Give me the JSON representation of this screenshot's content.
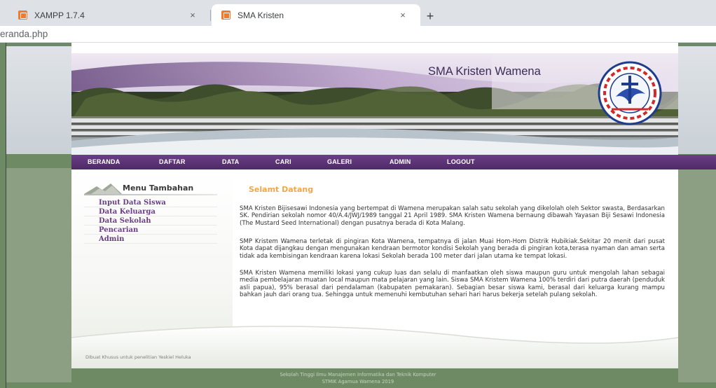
{
  "browser": {
    "tabs": [
      {
        "label": "XAMPP 1.7.4",
        "active": false
      },
      {
        "label": "SMA Kristen",
        "active": true
      }
    ],
    "close_glyph": "×",
    "new_tab_glyph": "+",
    "address": "eranda.php"
  },
  "header": {
    "site_title": "SMA Kristen Wamena"
  },
  "nav": {
    "items": [
      "BERANDA",
      "DAFTAR",
      "DATA",
      "CARI",
      "GALERI",
      "ADMIN",
      "LOGOUT"
    ]
  },
  "sidebar": {
    "title": "Menu Tambahan",
    "items": [
      "Input Data Siswa",
      "Data Keluarga",
      "Data Sekolah",
      "Pencarian",
      "Admin"
    ]
  },
  "main": {
    "welcome": "Selamt Datang",
    "paragraphs": [
      "SMA Kristen Bijisesawi Indonesia yang bertempat di Wamena merupakan salah satu sekolah yang dikelolah oleh Sektor swasta, Berdasarkan SK. Pendirian sekolah nomor 40/A.4/JWJ/1989 tanggal 21 April 1989. SMA Kristen Wamena bernaung dibawah Yayasan Biji Sesawi Indonesia (The Mustard Seed International) dengan pusatnya berada di Kota Malang.",
      "SMP Kristem Wamena terletak di pingiran Kota Wamena, tempatnya di jalan Muai Hom-Hom Distrik Hubikiak.Sekitar 20 menit dari pusat Kota dapat dijangkau dengan mengunakan kendraan bermotor kondisi Sekolah yang berada di pingiran kota,terasa nyaman dan aman serta tidak ada kembisingan kendraan karena lokasi Sekolah berada 100 meter dari jalan utama ke tempat lokasi.",
      "SMA Kristen Wamena memiliki lokasi yang cukup luas dan selalu di manfaatkan oleh siswa maupun guru untuk mengolah lahan sebagai media pembelajaran muatan local maupun mata pelajaran yang lain. Siswa SMA Kristem Wamena 100% terdiri dari putra daerah (penduduk asli papua), 95% berasal dari pendalaman (kabupaten pemakaran). Sebagian besar siswa kami, berasal dari keluarga kurang mampu bahkan jauh dari orang tua. Sehingga untuk memenuhi kembutuhan sehari hari harus bekerja setelah pulang sekolah."
    ]
  },
  "footer": {
    "left_note": "Dibuat Khusus untuk penelitian Yeskiel Heluka",
    "line1": "Sekolah Tinggi Ilmu Manajemen Informatika dan Teknik Komputer",
    "line2": "STMIK Agamua Wamena 2019"
  },
  "colors": {
    "nav_purple": "#5a3275",
    "accent_orange": "#f0a64a",
    "menu_purple": "#6a3c86",
    "page_green": "#6d8a64"
  }
}
